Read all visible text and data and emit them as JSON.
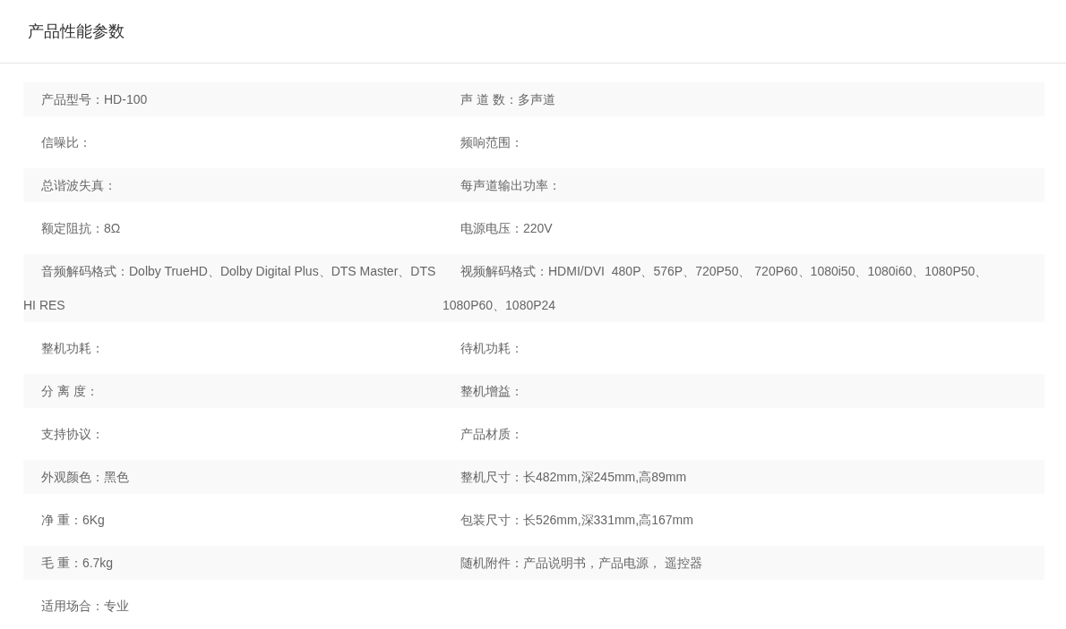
{
  "title": "产品性能参数",
  "rows": [
    [
      "产品型号：HD-100",
      "声 道 数：多声道"
    ],
    [
      "信噪比：",
      "频响范围："
    ],
    [
      "总谐波失真：",
      "每声道输出功率："
    ],
    [
      "额定阻抗：8Ω",
      "电源电压：220V"
    ],
    [
      "音频解码格式：Dolby TrueHD、Dolby Digital Plus、DTS Master、DTS HI RES",
      "视频解码格式：HDMI/DVI  480P、576P、720P50、 720P60、1080i50、1080i60、1080P50、1080P60、1080P24"
    ],
    [
      "整机功耗：",
      "待机功耗："
    ],
    [
      "分 离 度：",
      "整机增益："
    ],
    [
      "支持协议：",
      "产品材质："
    ],
    [
      "外观颜色：黑色",
      "整机尺寸：长482mm,深245mm,高89mm"
    ],
    [
      "净 重：6Kg",
      "包装尺寸：长526mm,深331mm,高167mm"
    ],
    [
      "毛 重：6.7kg",
      "随机附件：产品说明书，产品电源， 遥控器"
    ],
    [
      "适用场合：专业"
    ]
  ]
}
